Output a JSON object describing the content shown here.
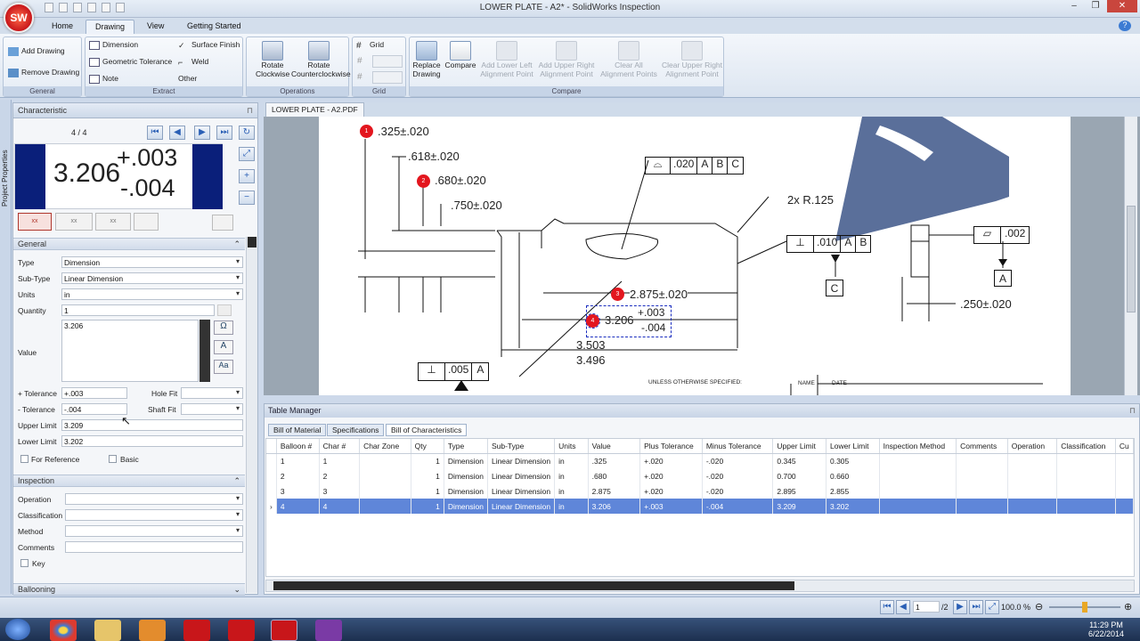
{
  "window": {
    "title": "LOWER PLATE - A2* - SolidWorks Inspection"
  },
  "tabs": [
    "Home",
    "Drawing",
    "View",
    "Getting Started"
  ],
  "ribbon": {
    "general": {
      "label": "General",
      "add": "Add Drawing",
      "remove": "Remove Drawing"
    },
    "extract": {
      "label": "Extract",
      "dimension": "Dimension",
      "gtol": "Geometric Tolerance",
      "note": "Note",
      "surface": "Surface Finish",
      "weld": "Weld",
      "other": "Other"
    },
    "operations": {
      "label": "Operations",
      "rot_cw": [
        "Rotate",
        "Clockwise"
      ],
      "rot_ccw": [
        "Rotate",
        "Counterclockwise"
      ]
    },
    "grid": {
      "label": "Grid",
      "grid": "Grid"
    },
    "compare": {
      "label": "Compare",
      "replace": [
        "Replace",
        "Drawing"
      ],
      "compare": "Compare",
      "lower_left": [
        "Add Lower Left",
        "Alignment Point"
      ],
      "upper_right": [
        "Add Upper Right",
        "Alignment Point"
      ],
      "clear_all": [
        "Clear All",
        "Alignment Points"
      ],
      "clear_ur": [
        "Clear Upper Right",
        "Alignment Point"
      ]
    }
  },
  "side_strip": "Project Properties",
  "characteristic": {
    "panel_title": "Characteristic",
    "counter": "4 / 4",
    "preview_value": "3.206",
    "preview_plus": "+.003",
    "preview_minus": "-.004"
  },
  "general": {
    "section": "General",
    "type_label": "Type",
    "type_value": "Dimension",
    "subtype_label": "Sub-Type",
    "subtype_value": "Linear Dimension",
    "units_label": "Units",
    "units_value": "in",
    "qty_label": "Quantity",
    "qty_value": "1",
    "value_label": "Value",
    "value_value": "3.206",
    "plus_tol_label": "+ Tolerance",
    "plus_tol_value": "+.003",
    "minus_tol_label": "- Tolerance",
    "minus_tol_value": "-.004",
    "hole_fit_label": "Hole Fit",
    "shaft_fit_label": "Shaft Fit",
    "upper_label": "Upper Limit",
    "upper_value": "3.209",
    "lower_label": "Lower Limit",
    "lower_value": "3.202",
    "for_ref": "For Reference",
    "basic": "Basic"
  },
  "inspection": {
    "section": "Inspection",
    "operation": "Operation",
    "classification": "Classification",
    "method": "Method",
    "comments": "Comments",
    "key": "Key"
  },
  "ballooning": "Ballooning",
  "doc_tab": "LOWER PLATE - A2.PDF",
  "drawing": {
    "d1": ".325±.020",
    "d_618": ".618±.020",
    "d2": ".680±.020",
    "d_750": ".750±.020",
    "fcf_top": [
      ".020",
      "A",
      "B",
      "C"
    ],
    "radius": "2x R.125",
    "fcf_perp": [
      ".010",
      "A",
      "B"
    ],
    "datum_c": "C",
    "fcf_flat": ".002",
    "datum_a": "A",
    "d3": "2.875±.020",
    "d4_val": "3.206",
    "d4_plus": "+.003",
    "d4_minus": "-.004",
    "d_3503": "3.503",
    "d_3496": "3.496",
    "d_250": ".250±.020",
    "fcf_bottom": [
      ".005",
      "A"
    ],
    "title_unless": "UNLESS OTHERWISE SPECIFIED:",
    "title_name": "NAME",
    "title_date": "DATE",
    "balloons": [
      "1",
      "2",
      "3",
      "4"
    ]
  },
  "table_manager": {
    "title": "Table Manager",
    "tabs": [
      "Bill of Material",
      "Specifications",
      "Bill of Characteristics"
    ],
    "columns": [
      "Balloon #",
      "Char #",
      "Char Zone",
      "Qty",
      "Type",
      "Sub-Type",
      "Units",
      "Value",
      "Plus Tolerance",
      "Minus Tolerance",
      "Upper Limit",
      "Lower Limit",
      "Inspection Method",
      "Comments",
      "Operation",
      "Classification",
      "Cu"
    ],
    "rows": [
      [
        "1",
        "1",
        "",
        "1",
        "Dimension",
        "Linear Dimension",
        "in",
        ".325",
        "+.020",
        "-.020",
        "0.345",
        "0.305",
        "",
        "",
        "",
        "",
        ""
      ],
      [
        "2",
        "2",
        "",
        "1",
        "Dimension",
        "Linear Dimension",
        "in",
        ".680",
        "+.020",
        "-.020",
        "0.700",
        "0.660",
        "",
        "",
        "",
        "",
        ""
      ],
      [
        "3",
        "3",
        "",
        "1",
        "Dimension",
        "Linear Dimension",
        "in",
        "2.875",
        "+.020",
        "-.020",
        "2.895",
        "2.855",
        "",
        "",
        "",
        "",
        ""
      ],
      [
        "4",
        "4",
        "",
        "1",
        "Dimension",
        "Linear Dimension",
        "in",
        "3.206",
        "+.003",
        "-.004",
        "3.209",
        "3.202",
        "",
        "",
        "",
        "",
        ""
      ]
    ]
  },
  "status": {
    "page": "1",
    "page_total": "/2",
    "zoom": "100.0 %"
  },
  "clock": {
    "time": "11:29 PM",
    "date": "6/22/2014"
  },
  "colors": {
    "balloon": "#e3161e",
    "selection": "#5f86d9",
    "preview_bg": "#0a1f7a"
  }
}
